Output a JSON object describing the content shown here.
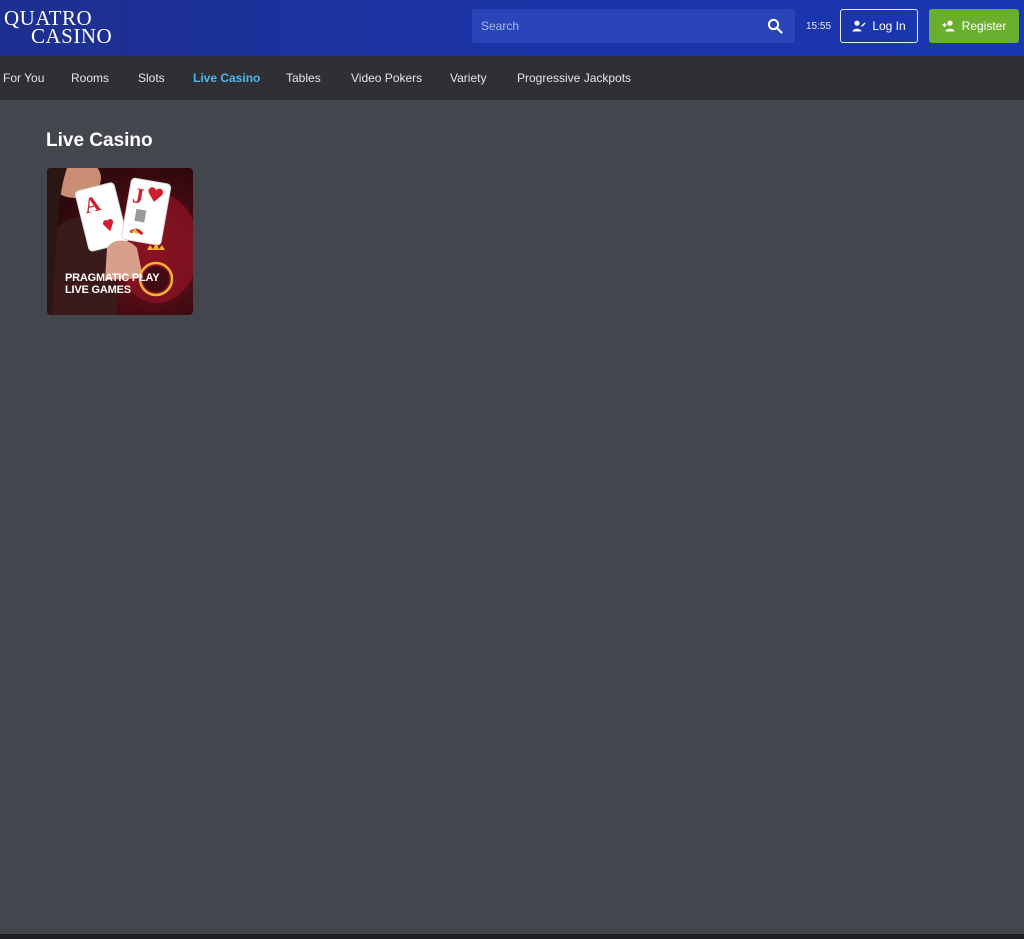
{
  "header": {
    "logo": {
      "line1": "QUATRO",
      "line2": "CASINO"
    },
    "search": {
      "placeholder": "Search",
      "icon": "search-icon"
    },
    "clock": "15:55",
    "login_label": "Log In",
    "register_label": "Register",
    "colors": {
      "header_bg": "#1b34a8",
      "register_bg": "#6aae2e"
    }
  },
  "nav": {
    "items": [
      {
        "label": "For You"
      },
      {
        "label": "Rooms"
      },
      {
        "label": "Slots"
      },
      {
        "label": "Live Casino",
        "active": true
      },
      {
        "label": "Tables"
      },
      {
        "label": "Video Pokers"
      },
      {
        "label": "Variety"
      },
      {
        "label": "Progressive Jackpots"
      }
    ],
    "active_color": "#4db8f0"
  },
  "main": {
    "title": "Live Casino",
    "games": [
      {
        "brand_line1": "PRAGMATIC PLAY",
        "brand_line2": "LIVE GAMES"
      }
    ]
  }
}
